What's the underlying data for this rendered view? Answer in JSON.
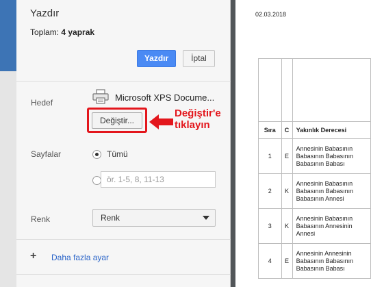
{
  "dialog": {
    "title": "Yazdır",
    "total_label": "Toplam:",
    "total_value": "4 yaprak",
    "print_button": "Yazdır",
    "cancel_button": "İptal"
  },
  "destination": {
    "label": "Hedef",
    "printer_icon": "printer-icon",
    "printer_name": "Microsoft XPS Docume...",
    "change_button": "Değiştir..."
  },
  "pages": {
    "label": "Sayfalar",
    "all_option": "Tümü",
    "all_selected": true,
    "range_placeholder": "ör. 1-5, 8, 11-13"
  },
  "color": {
    "label": "Renk",
    "selected": "Renk"
  },
  "more_settings": {
    "icon": "plus-icon",
    "label": "Daha fazla ayar"
  },
  "annotation": {
    "line1": "Değiştir'e",
    "line2": "tıklayın",
    "color": "#e3161c"
  },
  "preview": {
    "date": "02.03.2018",
    "columns": [
      "Sıra",
      "C",
      "Yakınlık Derecesi"
    ],
    "rows": [
      {
        "sira": "1",
        "c": "E",
        "lines": [
          "Annesinin Babasının",
          "Babasının Babasının",
          "Babasının Babası"
        ]
      },
      {
        "sira": "2",
        "c": "K",
        "lines": [
          "Annesinin Babasının",
          "Babasının Babasının",
          "Babasının Annesi"
        ]
      },
      {
        "sira": "3",
        "c": "K",
        "lines": [
          "Annesinin Babasının",
          "Babasının Annesinin",
          "Annesi"
        ]
      },
      {
        "sira": "4",
        "c": "E",
        "lines": [
          "Annesinin Annesinin",
          "Babasının Babasının",
          "Babasının Babası"
        ]
      }
    ]
  },
  "colors": {
    "print_button": "#4a8af4",
    "link": "#2a64c8",
    "preview_background": "#525659"
  }
}
